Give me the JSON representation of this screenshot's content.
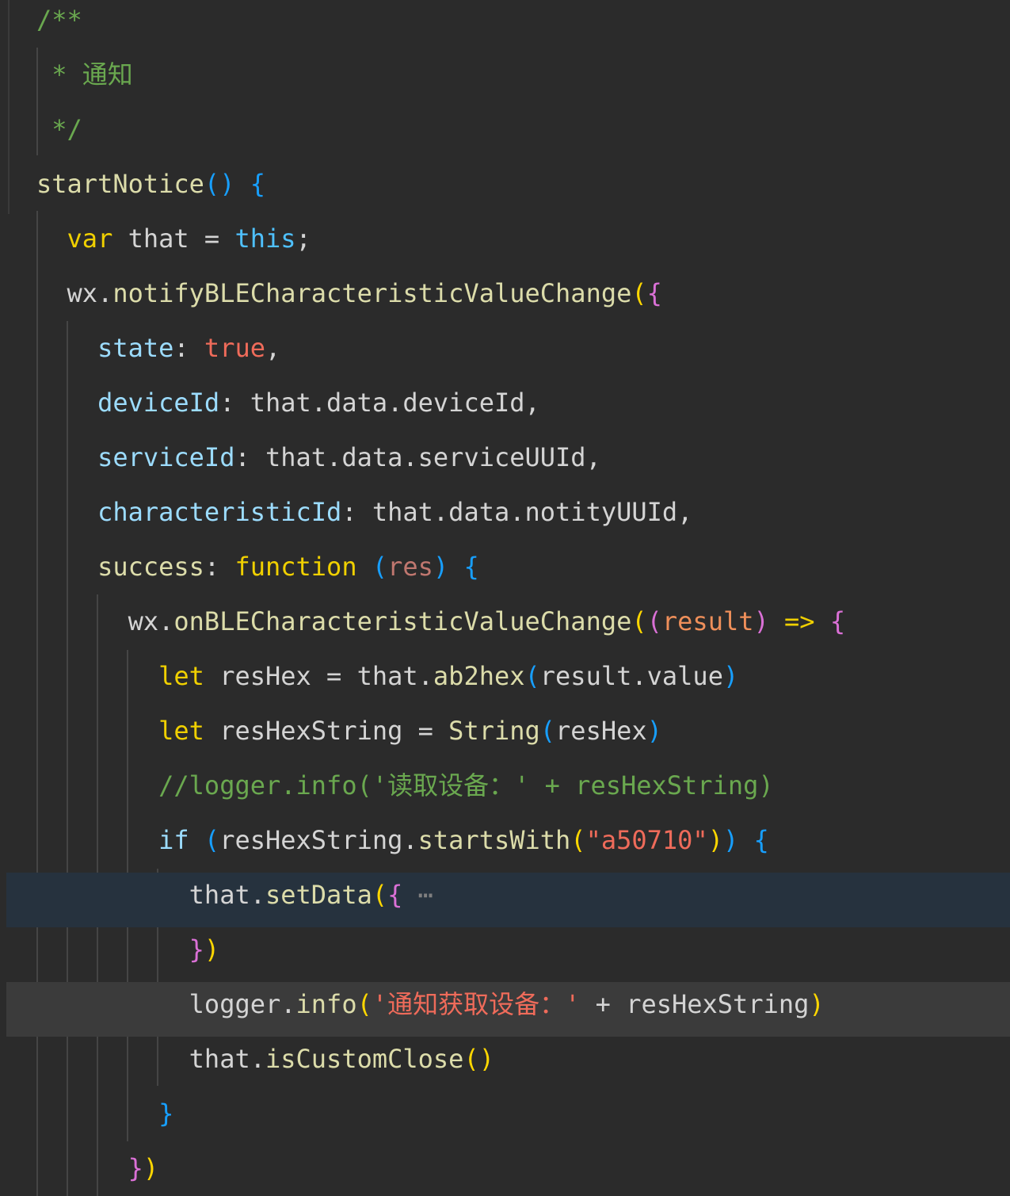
{
  "editor": {
    "lines": [
      {
        "tokens": [
          {
            "t": "/**",
            "c": "#6aa84f"
          }
        ]
      },
      {
        "tokens": [
          {
            "t": " * ",
            "c": "#6aa84f"
          },
          {
            "t": "通知",
            "c": "#6aa84f"
          }
        ]
      },
      {
        "tokens": [
          {
            "t": " */",
            "c": "#6aa84f"
          }
        ]
      },
      {
        "tokens": [
          {
            "t": "startNotice",
            "c": "#dcdcaa"
          },
          {
            "t": "()",
            "c": "#179fff"
          },
          {
            "t": " ",
            "c": "#d4d4d4"
          },
          {
            "t": "{",
            "c": "#179fff"
          }
        ]
      },
      {
        "tokens": [
          {
            "t": "  ",
            "c": "#d4d4d4"
          },
          {
            "t": "var",
            "c": "#f0d000"
          },
          {
            "t": " that ",
            "c": "#d4d4d4"
          },
          {
            "t": "=",
            "c": "#d4d4d4"
          },
          {
            "t": " ",
            "c": "#d4d4d4"
          },
          {
            "t": "this",
            "c": "#4fc1ff"
          },
          {
            "t": ";",
            "c": "#d4d4d4"
          }
        ]
      },
      {
        "tokens": [
          {
            "t": "  ",
            "c": "#d4d4d4"
          },
          {
            "t": "wx",
            "c": "#d4d4d4"
          },
          {
            "t": ".",
            "c": "#d4d4d4"
          },
          {
            "t": "notifyBLECharacteristicValueChange",
            "c": "#dcdcaa"
          },
          {
            "t": "(",
            "c": "#ffd700"
          },
          {
            "t": "{",
            "c": "#da70d6"
          }
        ]
      },
      {
        "tokens": [
          {
            "t": "    ",
            "c": "#d4d4d4"
          },
          {
            "t": "state",
            "c": "#9cdcfe"
          },
          {
            "t": ": ",
            "c": "#d4d4d4"
          },
          {
            "t": "true",
            "c": "#ef6b5a"
          },
          {
            "t": ",",
            "c": "#d4d4d4"
          }
        ]
      },
      {
        "tokens": [
          {
            "t": "    ",
            "c": "#d4d4d4"
          },
          {
            "t": "deviceId",
            "c": "#9cdcfe"
          },
          {
            "t": ": that.data.deviceId,",
            "c": "#d4d4d4"
          }
        ]
      },
      {
        "tokens": [
          {
            "t": "    ",
            "c": "#d4d4d4"
          },
          {
            "t": "serviceId",
            "c": "#9cdcfe"
          },
          {
            "t": ": that.data.serviceUUId,",
            "c": "#d4d4d4"
          }
        ]
      },
      {
        "tokens": [
          {
            "t": "    ",
            "c": "#d4d4d4"
          },
          {
            "t": "characteristicId",
            "c": "#9cdcfe"
          },
          {
            "t": ": that.data.notityUUId,",
            "c": "#d4d4d4"
          }
        ]
      },
      {
        "tokens": [
          {
            "t": "    ",
            "c": "#d4d4d4"
          },
          {
            "t": "success",
            "c": "#dcdcaa"
          },
          {
            "t": ": ",
            "c": "#d4d4d4"
          },
          {
            "t": "function",
            "c": "#f0d000"
          },
          {
            "t": " ",
            "c": "#d4d4d4"
          },
          {
            "t": "(",
            "c": "#179fff"
          },
          {
            "t": "res",
            "c": "#c0776f"
          },
          {
            "t": ")",
            "c": "#179fff"
          },
          {
            "t": " ",
            "c": "#d4d4d4"
          },
          {
            "t": "{",
            "c": "#179fff"
          }
        ]
      },
      {
        "tokens": [
          {
            "t": "      ",
            "c": "#d4d4d4"
          },
          {
            "t": "wx",
            "c": "#d4d4d4"
          },
          {
            "t": ".",
            "c": "#d4d4d4"
          },
          {
            "t": "onBLECharacteristicValueChange",
            "c": "#dcdcaa"
          },
          {
            "t": "(",
            "c": "#ffd700"
          },
          {
            "t": "(",
            "c": "#da70d6"
          },
          {
            "t": "result",
            "c": "#ef8f5a"
          },
          {
            "t": ")",
            "c": "#da70d6"
          },
          {
            "t": " ",
            "c": "#d4d4d4"
          },
          {
            "t": "=>",
            "c": "#f0d000"
          },
          {
            "t": " ",
            "c": "#d4d4d4"
          },
          {
            "t": "{",
            "c": "#da70d6"
          }
        ]
      },
      {
        "tokens": [
          {
            "t": "        ",
            "c": "#d4d4d4"
          },
          {
            "t": "let",
            "c": "#f0d000"
          },
          {
            "t": " resHex ",
            "c": "#d4d4d4"
          },
          {
            "t": "=",
            "c": "#d4d4d4"
          },
          {
            "t": " that.",
            "c": "#d4d4d4"
          },
          {
            "t": "ab2hex",
            "c": "#dcdcaa"
          },
          {
            "t": "(",
            "c": "#179fff"
          },
          {
            "t": "result.value",
            "c": "#d4d4d4"
          },
          {
            "t": ")",
            "c": "#179fff"
          }
        ]
      },
      {
        "tokens": [
          {
            "t": "        ",
            "c": "#d4d4d4"
          },
          {
            "t": "let",
            "c": "#f0d000"
          },
          {
            "t": " resHexString ",
            "c": "#d4d4d4"
          },
          {
            "t": "=",
            "c": "#d4d4d4"
          },
          {
            "t": " ",
            "c": "#d4d4d4"
          },
          {
            "t": "String",
            "c": "#dcdcaa"
          },
          {
            "t": "(",
            "c": "#179fff"
          },
          {
            "t": "resHex",
            "c": "#d4d4d4"
          },
          {
            "t": ")",
            "c": "#179fff"
          }
        ]
      },
      {
        "tokens": [
          {
            "t": "        ",
            "c": "#d4d4d4"
          },
          {
            "t": "//logger.info('读取设备：' + resHexString)",
            "c": "#6aa84f"
          }
        ]
      },
      {
        "tokens": [
          {
            "t": "        ",
            "c": "#d4d4d4"
          },
          {
            "t": "if",
            "c": "#9cdcfe"
          },
          {
            "t": " ",
            "c": "#d4d4d4"
          },
          {
            "t": "(",
            "c": "#179fff"
          },
          {
            "t": "resHexString.",
            "c": "#d4d4d4"
          },
          {
            "t": "startsWith",
            "c": "#dcdcaa"
          },
          {
            "t": "(",
            "c": "#ffd700"
          },
          {
            "t": "\"a50710\"",
            "c": "#ef6b5a"
          },
          {
            "t": ")",
            "c": "#ffd700"
          },
          {
            "t": ")",
            "c": "#179fff"
          },
          {
            "t": " ",
            "c": "#d4d4d4"
          },
          {
            "t": "{",
            "c": "#179fff"
          }
        ]
      },
      {
        "tokens": [
          {
            "t": "          ",
            "c": "#d4d4d4"
          },
          {
            "t": "that",
            "c": "#d4d4d4"
          },
          {
            "t": ".",
            "c": "#d4d4d4"
          },
          {
            "t": "setData",
            "c": "#dcdcaa"
          },
          {
            "t": "(",
            "c": "#ffd700"
          },
          {
            "t": "{",
            "c": "#da70d6"
          },
          {
            "t": " ⋯",
            "c": "#7f7f7f"
          }
        ]
      },
      {
        "tokens": [
          {
            "t": "          ",
            "c": "#d4d4d4"
          },
          {
            "t": "}",
            "c": "#da70d6"
          },
          {
            "t": ")",
            "c": "#ffd700"
          }
        ]
      },
      {
        "tokens": [
          {
            "t": "          ",
            "c": "#d4d4d4"
          },
          {
            "t": "logger",
            "c": "#d4d4d4"
          },
          {
            "t": ".",
            "c": "#d4d4d4"
          },
          {
            "t": "info",
            "c": "#dcdcaa"
          },
          {
            "t": "(",
            "c": "#ffd700"
          },
          {
            "t": "'通知获取设备：'",
            "c": "#ef6b5a"
          },
          {
            "t": " + resHexString",
            "c": "#d4d4d4"
          },
          {
            "t": ")",
            "c": "#ffd700"
          }
        ]
      },
      {
        "tokens": [
          {
            "t": "          ",
            "c": "#d4d4d4"
          },
          {
            "t": "that",
            "c": "#d4d4d4"
          },
          {
            "t": ".",
            "c": "#d4d4d4"
          },
          {
            "t": "isCustomClose",
            "c": "#dcdcaa"
          },
          {
            "t": "()",
            "c": "#ffd700"
          }
        ]
      },
      {
        "tokens": [
          {
            "t": "        ",
            "c": "#d4d4d4"
          },
          {
            "t": "}",
            "c": "#179fff"
          }
        ]
      },
      {
        "tokens": [
          {
            "t": "      ",
            "c": "#d4d4d4"
          },
          {
            "t": "}",
            "c": "#da70d6"
          },
          {
            "t": ")",
            "c": "#ffd700"
          }
        ]
      }
    ]
  },
  "colors": {
    "background": "#2b2b2b",
    "highlight_blue": "#26323e",
    "highlight_gray": "#3b3b3b",
    "indent_guide": "#454545"
  }
}
